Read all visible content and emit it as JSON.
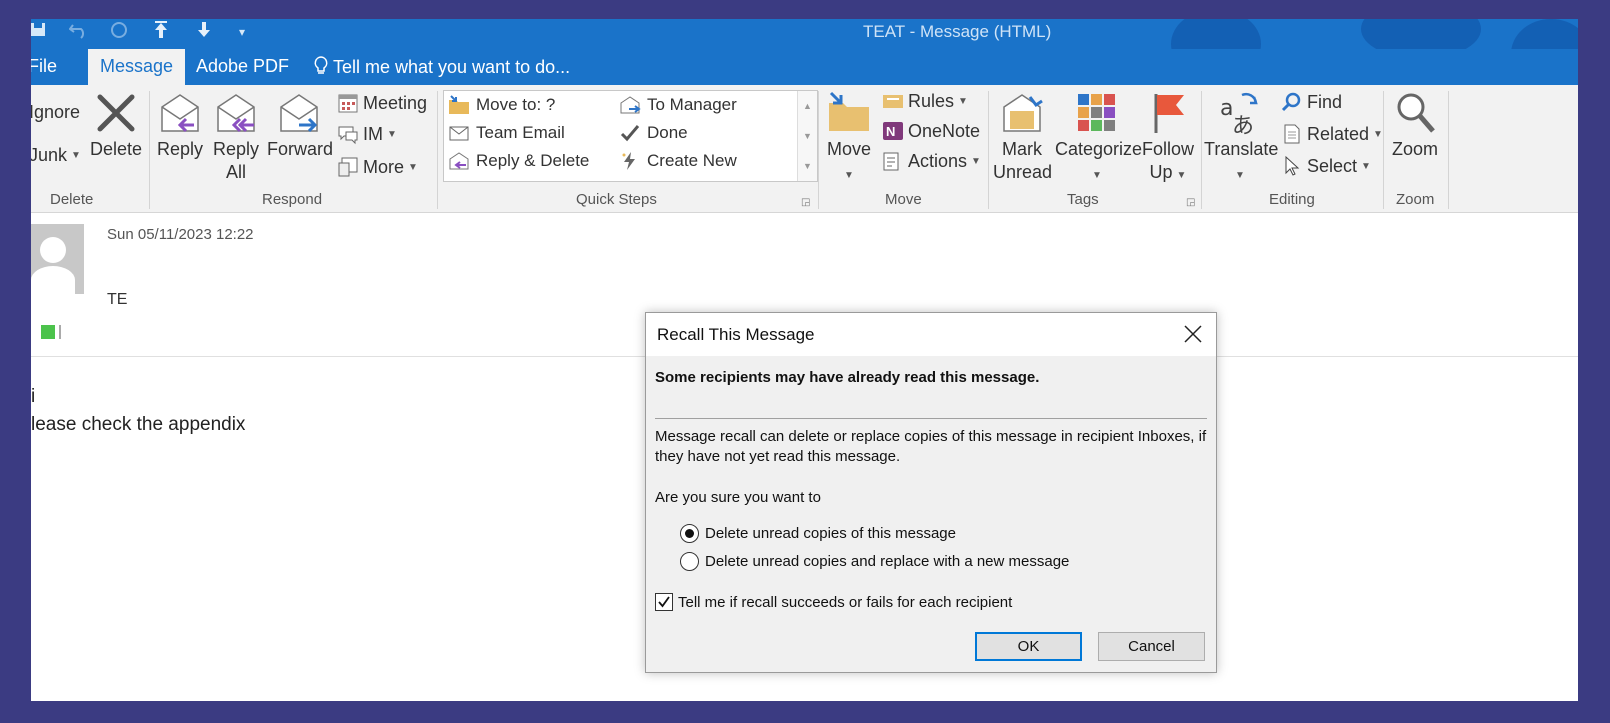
{
  "window": {
    "title": "TEAT - Message (HTML)"
  },
  "ribbon_tabs": [
    {
      "label": "File"
    },
    {
      "label": "Message",
      "active": true
    },
    {
      "label": "Adobe PDF"
    },
    {
      "label": "Tell me what you want to do..."
    }
  ],
  "ribbon": {
    "delete_group": {
      "label": "Delete",
      "ignore": "Ignore",
      "junk": "Junk",
      "delete": "Delete"
    },
    "respond_group": {
      "label": "Respond",
      "reply": "Reply",
      "reply_all_1": "Reply",
      "reply_all_2": "All",
      "forward": "Forward",
      "meeting": "Meeting",
      "im": "IM",
      "more": "More"
    },
    "quick_steps_group": {
      "label": "Quick Steps",
      "items": [
        "Move to: ?",
        "To Manager",
        "Team Email",
        "Done",
        "Reply & Delete",
        "Create New"
      ]
    },
    "move_group": {
      "label": "Move",
      "move": "Move",
      "rules": "Rules",
      "onenote": "OneNote",
      "actions": "Actions"
    },
    "tags_group": {
      "label": "Tags",
      "mark_unread_1": "Mark",
      "mark_unread_2": "Unread",
      "categorize": "Categorize",
      "follow_up_1": "Follow",
      "follow_up_2": "Up"
    },
    "editing_group": {
      "label": "Editing",
      "translate": "Translate",
      "find": "Find",
      "related": "Related",
      "select": "Select"
    },
    "zoom_group": {
      "label": "Zoom",
      "zoom": "Zoom"
    }
  },
  "message": {
    "date": "Sun 05/11/2023 12:22",
    "sender": "TE",
    "body_line_1": "i",
    "body_line_2": "lease check the appendix"
  },
  "dialog": {
    "title": "Recall This Message",
    "warning": "Some recipients may have already read this message.",
    "description": "Message recall can delete or replace copies of this message in recipient Inboxes, if they have not yet read this message.",
    "question": "Are you sure you want to",
    "options": [
      {
        "label": "Delete unread copies of this message",
        "selected": true
      },
      {
        "label": "Delete unread copies and replace with a new message",
        "selected": false
      }
    ],
    "checkbox": {
      "label": "Tell me if recall succeeds or fails for each recipient",
      "checked": true
    },
    "ok_label": "OK",
    "cancel_label": "Cancel"
  },
  "colors": {
    "accent": "#1a73c9",
    "ribbon_bg": "#f2f2f2",
    "backdrop": "#3b3b82",
    "category": "#4cc34c"
  }
}
